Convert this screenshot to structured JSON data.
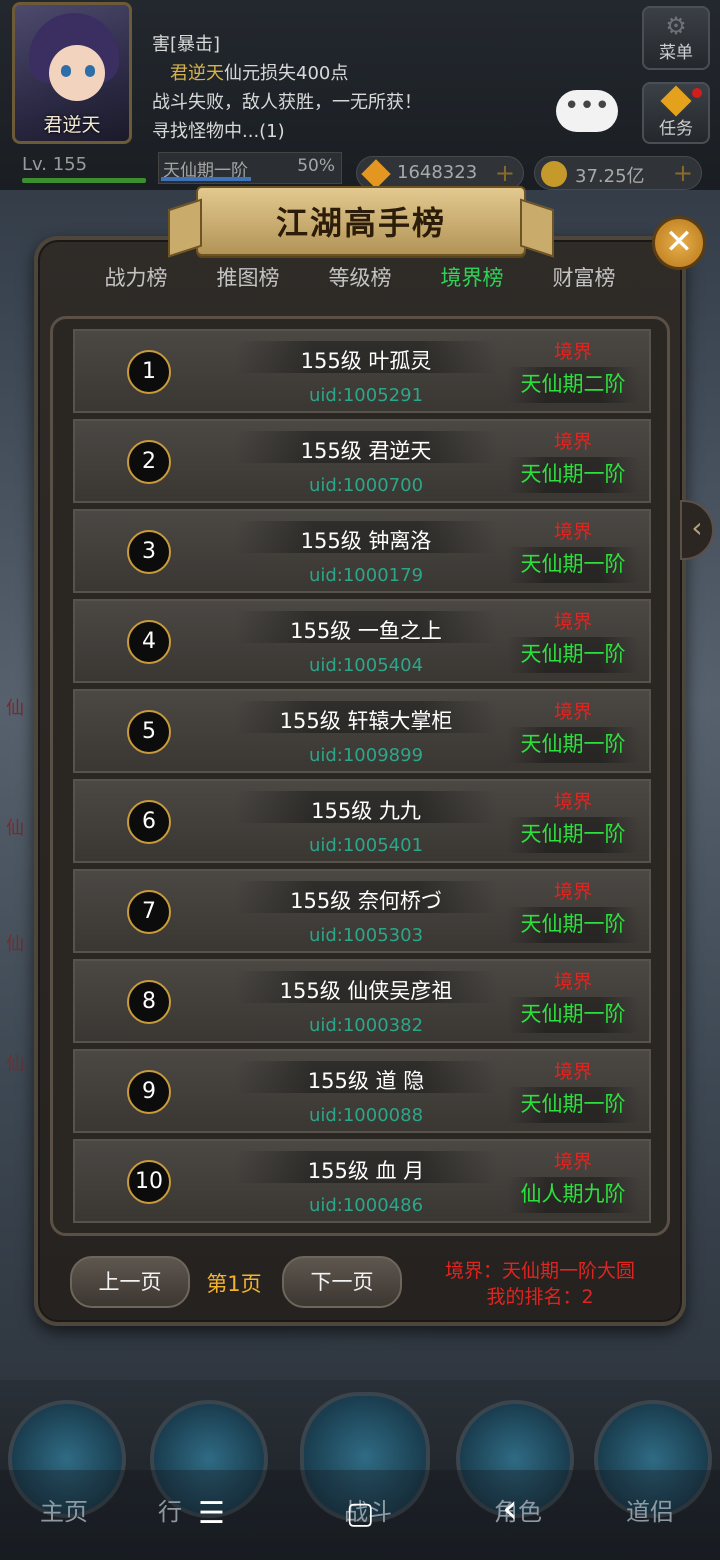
{
  "player": {
    "name": "君逆天",
    "level_text": "Lv. 155",
    "realm": "天仙期一阶",
    "realm_progress": "50%",
    "realm_progress_value": 0.5
  },
  "log": {
    "line1": "害[暴击]",
    "line2_name": "君逆天",
    "line2_rest": "仙元损失400点",
    "line3": "战斗失败，敌人获胜，一无所获！",
    "line4": "寻找怪物中...(1)"
  },
  "menu": {
    "menu_label": "菜单",
    "task_label": "任务"
  },
  "currency": {
    "gems": "1648323",
    "gold": "37.25亿",
    "plus": "+"
  },
  "panel": {
    "title": "江湖高手榜",
    "close": "✕"
  },
  "tabs": [
    {
      "label": "战力榜",
      "active": false
    },
    {
      "label": "推图榜",
      "active": false
    },
    {
      "label": "等级榜",
      "active": false
    },
    {
      "label": "境界榜",
      "active": true
    },
    {
      "label": "财富榜",
      "active": false
    }
  ],
  "rows": [
    {
      "rank": "1",
      "name": "155级 叶孤灵",
      "uid": "uid:1005291",
      "label": "境界",
      "realm": "天仙期二阶"
    },
    {
      "rank": "2",
      "name": "155级 君逆天",
      "uid": "uid:1000700",
      "label": "境界",
      "realm": "天仙期一阶"
    },
    {
      "rank": "3",
      "name": "155级 钟离洛",
      "uid": "uid:1000179",
      "label": "境界",
      "realm": "天仙期一阶"
    },
    {
      "rank": "4",
      "name": "155级 一鱼之上",
      "uid": "uid:1005404",
      "label": "境界",
      "realm": "天仙期一阶"
    },
    {
      "rank": "5",
      "name": "155级 轩辕大掌柜",
      "uid": "uid:1009899",
      "label": "境界",
      "realm": "天仙期一阶"
    },
    {
      "rank": "6",
      "name": "155级 九九",
      "uid": "uid:1005401",
      "label": "境界",
      "realm": "天仙期一阶"
    },
    {
      "rank": "7",
      "name": "155级 奈何桥づ",
      "uid": "uid:1005303",
      "label": "境界",
      "realm": "天仙期一阶"
    },
    {
      "rank": "8",
      "name": "155级 仙侠吴彦祖",
      "uid": "uid:1000382",
      "label": "境界",
      "realm": "天仙期一阶"
    },
    {
      "rank": "9",
      "name": "155级 道 隐",
      "uid": "uid:1000088",
      "label": "境界",
      "realm": "天仙期一阶"
    },
    {
      "rank": "10",
      "name": "155级 血 月",
      "uid": "uid:1000486",
      "label": "境界",
      "realm": "仙人期九阶"
    }
  ],
  "pager": {
    "prev": "上一页",
    "page": "第1页",
    "next": "下一页"
  },
  "my": {
    "realm": "境界：天仙期一阶大圆",
    "rank": "我的排名：2"
  },
  "side_chars": [
    "仙",
    "仙",
    "仙",
    "仙"
  ],
  "bottom_nav": [
    "主页",
    "行",
    "战斗",
    "角色",
    "道侣"
  ],
  "system_nav": {
    "menu": "☰",
    "home": "▢",
    "back": "‹"
  }
}
